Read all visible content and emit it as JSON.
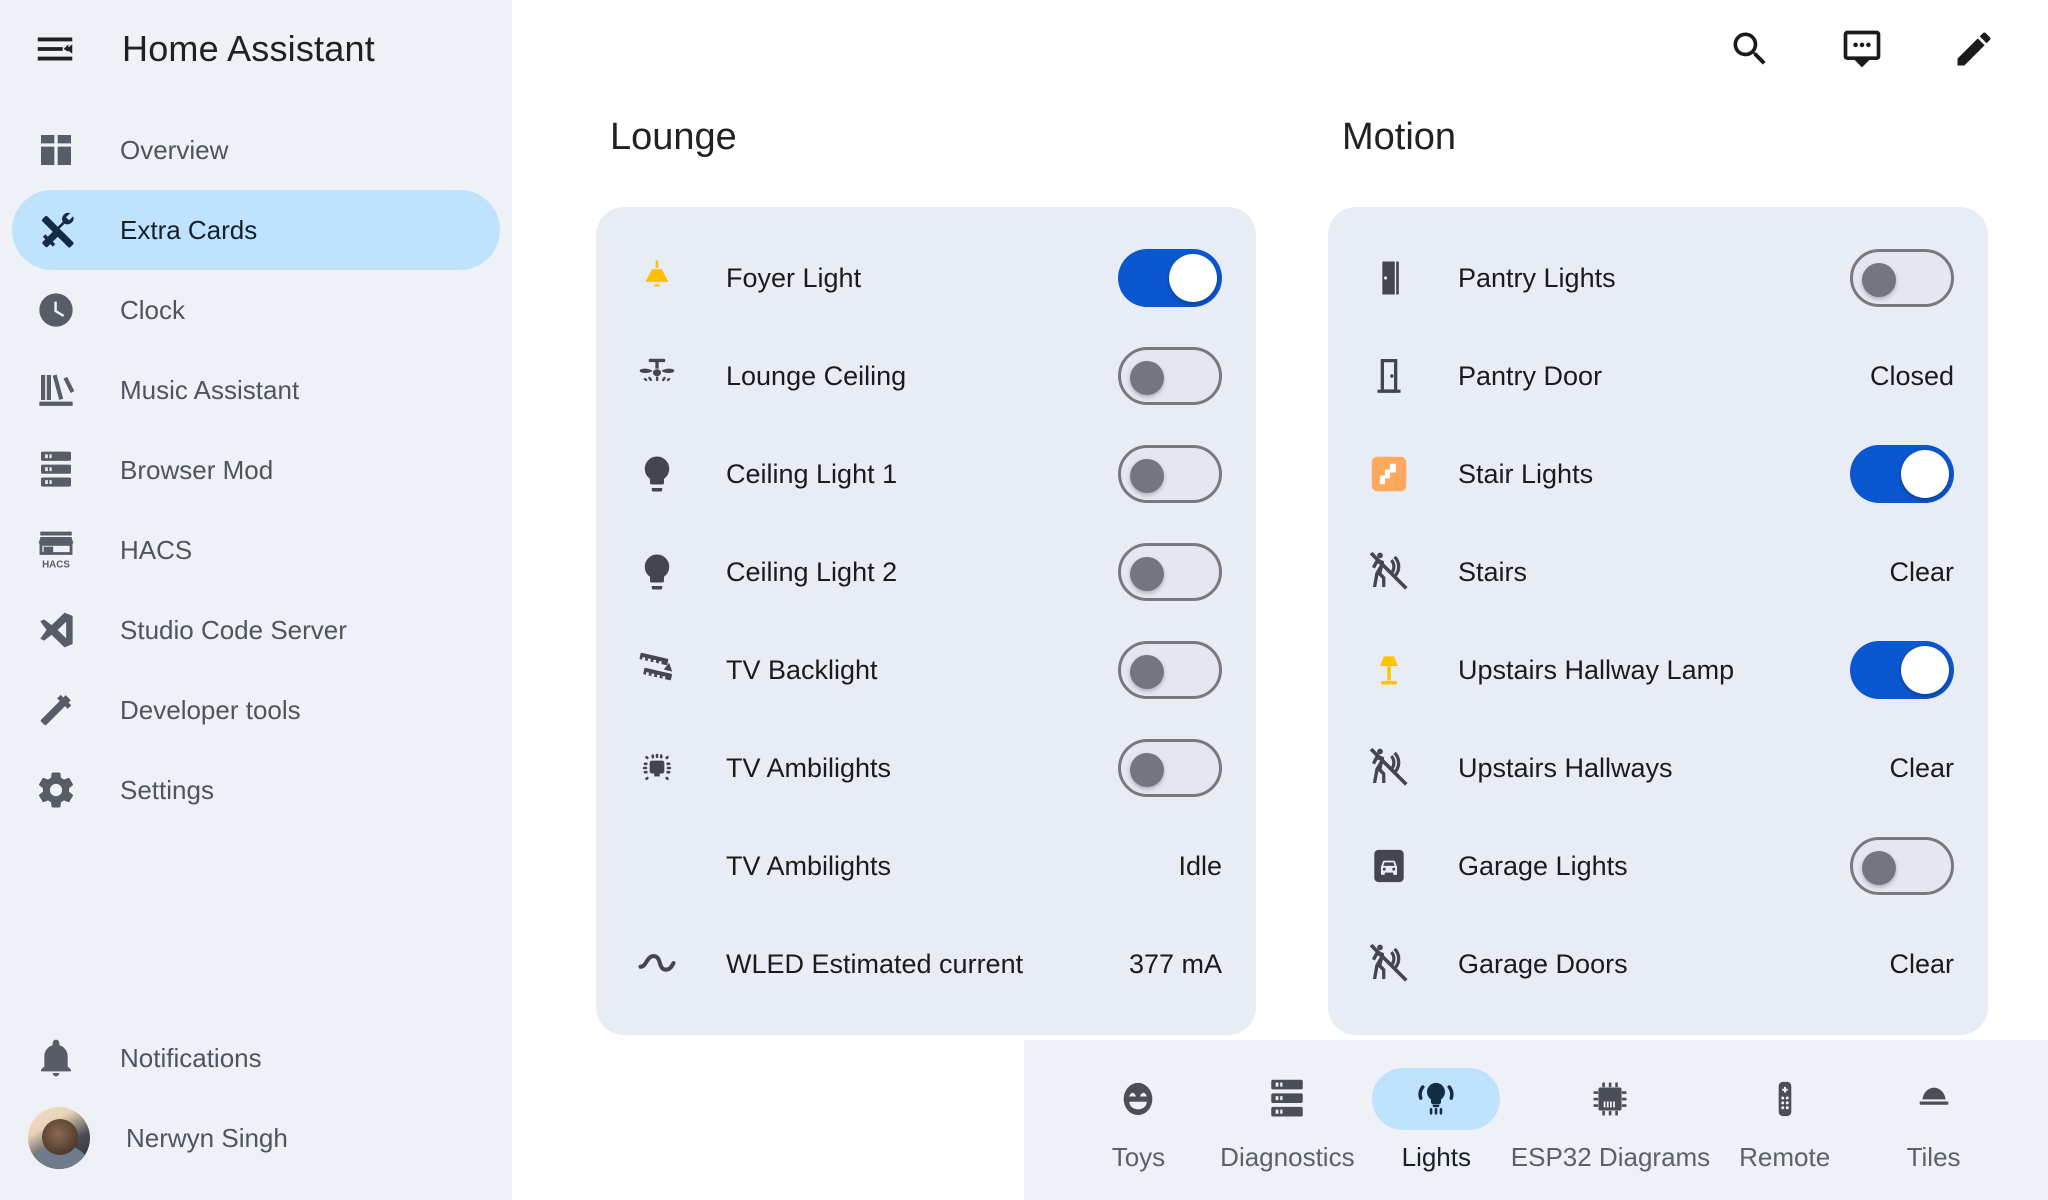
{
  "sidebar": {
    "title": "Home Assistant",
    "menu_icon": "menu-collapse-icon",
    "items": [
      {
        "label": "Overview",
        "icon": "view-dashboard-icon",
        "active": false
      },
      {
        "label": "Extra Cards",
        "icon": "tools-icon",
        "active": true
      },
      {
        "label": "Clock",
        "icon": "clock-icon",
        "active": false
      },
      {
        "label": "Music Assistant",
        "icon": "bookshelf-icon",
        "active": false
      },
      {
        "label": "Browser Mod",
        "icon": "server-icon",
        "active": false
      },
      {
        "label": "HACS",
        "icon": "hacs-storefront-icon",
        "active": false
      },
      {
        "label": "Studio Code Server",
        "icon": "vscode-icon",
        "active": false
      },
      {
        "label": "Developer tools",
        "icon": "hammer-icon",
        "active": false
      },
      {
        "label": "Settings",
        "icon": "cog-icon",
        "active": false
      },
      {
        "label": "Notifications",
        "icon": "bell-icon",
        "active": false
      }
    ],
    "user": {
      "name": "Nerwyn Singh",
      "avatar": "user-avatar"
    }
  },
  "topbar": {
    "buttons": [
      {
        "name": "search-icon",
        "label": "Search"
      },
      {
        "name": "assist-chat-icon",
        "label": "Assist"
      },
      {
        "name": "edit-pencil-icon",
        "label": "Edit dashboard"
      }
    ]
  },
  "columns": [
    {
      "title": "Lounge",
      "rows": [
        {
          "label": "Foyer Light",
          "icon": "ceiling-light-icon",
          "icon_color": "#ffbe00",
          "control": "toggle",
          "state": "on"
        },
        {
          "label": "Lounge Ceiling",
          "icon": "ceiling-fan-light-icon",
          "icon_color": "#44464f",
          "control": "toggle",
          "state": "off"
        },
        {
          "label": "Ceiling Light 1",
          "icon": "lightbulb-icon",
          "icon_color": "#44464f",
          "control": "toggle",
          "state": "off"
        },
        {
          "label": "Ceiling Light 2",
          "icon": "lightbulb-icon",
          "icon_color": "#44464f",
          "control": "toggle",
          "state": "off"
        },
        {
          "label": "TV Backlight",
          "icon": "led-strip-icon",
          "icon_color": "#44464f",
          "control": "toggle",
          "state": "off"
        },
        {
          "label": "TV Ambilights",
          "icon": "ambilight-icon",
          "icon_color": "#44464f",
          "control": "toggle",
          "state": "off"
        },
        {
          "label": "TV Ambilights",
          "icon": "",
          "icon_color": "",
          "control": "text",
          "value": "Idle"
        },
        {
          "label": "WLED Estimated current",
          "icon": "current-ac-icon",
          "icon_color": "#44464f",
          "control": "text",
          "value": "377 mA"
        }
      ]
    },
    {
      "title": "Motion",
      "rows": [
        {
          "label": "Pantry Lights",
          "icon": "door-open-icon",
          "icon_color": "#44464f",
          "control": "toggle",
          "state": "off"
        },
        {
          "label": "Pantry Door",
          "icon": "door-closed-icon",
          "icon_color": "#44464f",
          "control": "text",
          "value": "Closed"
        },
        {
          "label": "Stair Lights",
          "icon": "stairs-icon",
          "icon_color": "#ffa95f",
          "control": "toggle",
          "state": "on"
        },
        {
          "label": "Stairs",
          "icon": "motion-sensor-off-icon",
          "icon_color": "#44464f",
          "control": "text",
          "value": "Clear"
        },
        {
          "label": "Upstairs Hallway Lamp",
          "icon": "floor-lamp-icon",
          "icon_color": "#ffc400",
          "control": "toggle",
          "state": "on"
        },
        {
          "label": "Upstairs Hallways",
          "icon": "motion-sensor-off-icon",
          "icon_color": "#44464f",
          "control": "text",
          "value": "Clear"
        },
        {
          "label": "Garage Lights",
          "icon": "garage-car-icon",
          "icon_color": "#44464f",
          "control": "toggle",
          "state": "off"
        },
        {
          "label": "Garage Doors",
          "icon": "motion-sensor-off-icon",
          "icon_color": "#44464f",
          "control": "text",
          "value": "Clear"
        }
      ]
    }
  ],
  "bottom_nav": [
    {
      "label": "Toys",
      "icon": "emoticon-icon",
      "active": false
    },
    {
      "label": "Diagnostics",
      "icon": "server-icon",
      "active": false
    },
    {
      "label": "Lights",
      "icon": "lightbulb-group-icon",
      "active": true
    },
    {
      "label": "ESP32 Diagrams",
      "icon": "chip-icon",
      "active": false
    },
    {
      "label": "Remote",
      "icon": "remote-icon",
      "active": false
    },
    {
      "label": "Tiles",
      "icon": "dome-light-icon",
      "active": false
    }
  ],
  "colors": {
    "accent_blue": "#0b57d0",
    "active_pill": "#bfe2fd",
    "card_bg": "#e8ecf5",
    "sidebar_bg": "#eef1f6",
    "icon_gray": "#44464f",
    "amber": "#ffbe00"
  }
}
